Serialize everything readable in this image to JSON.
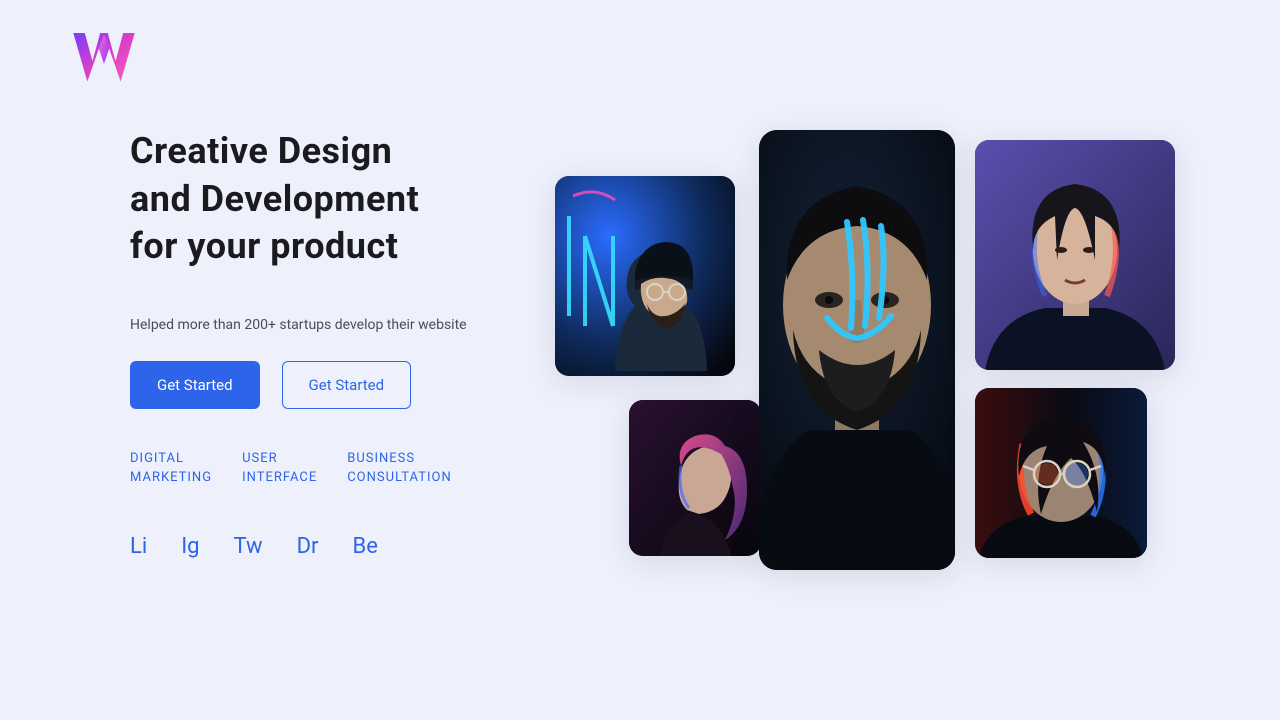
{
  "brand": {
    "name": "W"
  },
  "hero": {
    "headline_l1": "Creative Design",
    "headline_l2": "and Development",
    "headline_l3": "for your product",
    "subtitle": "Helped more than 200+ startups develop their website"
  },
  "cta": {
    "primary": "Get Started",
    "secondary": "Get Started"
  },
  "tags": {
    "t1": "DIGITAL\nMARKETING",
    "t2": "USER\nINTERFACE",
    "t3": "BUSINESS\nCONSULTATION"
  },
  "socials": {
    "li": "Li",
    "ig": "Ig",
    "tw": "Tw",
    "dr": "Dr",
    "be": "Be"
  },
  "gallery": {
    "neon": "portrait-beard-beanie-neon",
    "pink": "portrait-profile-pink",
    "center": "portrait-face-paint-dark",
    "top": "portrait-woman-purple",
    "glasses": "portrait-glasses-red-blue"
  },
  "colors": {
    "accent": "#2d64ea",
    "bg": "#eef1fb"
  }
}
